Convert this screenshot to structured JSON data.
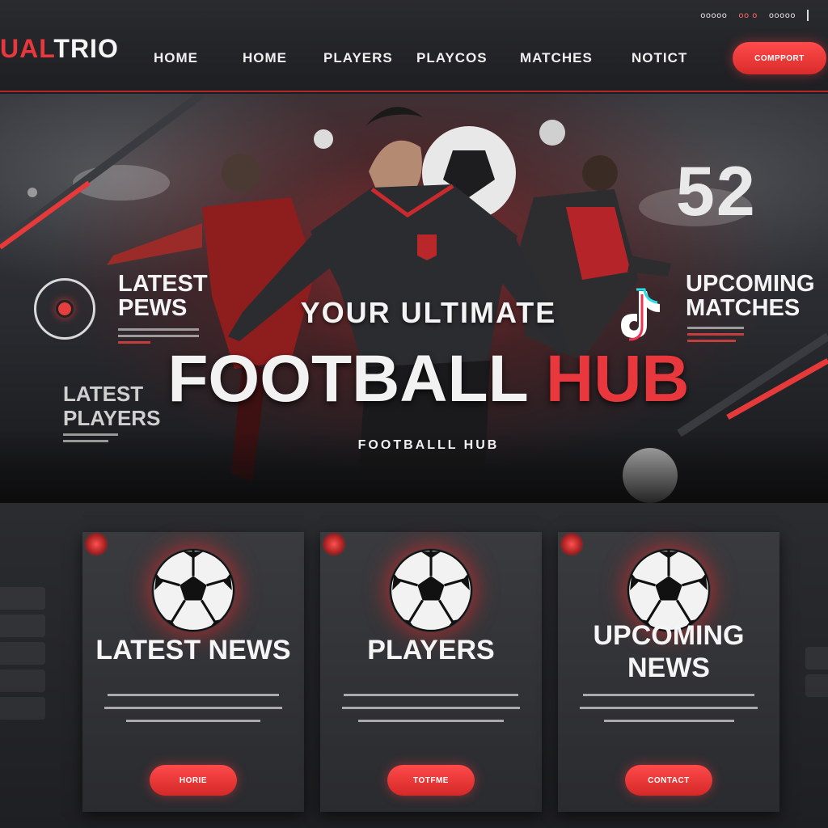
{
  "brand": {
    "logo_prefix": "UAL",
    "logo_main": "TRIO"
  },
  "utility": [
    "ooooo",
    "oo o",
    "ooooo"
  ],
  "nav": [
    "HOME",
    "HOME",
    "PLAYERS",
    "PLAYCOS",
    "MATCHES",
    "NOTICT"
  ],
  "header_cta": "COMPPORT",
  "hero": {
    "subtitle": "YOUR ULTIMATE",
    "title_main": "FOOTBALL",
    "title_accent": "HUB",
    "tagline": "FOOTBALLL HUB",
    "score": "52",
    "left_callout": "LATEST PEWS",
    "right_callout": "UPCOMING MATCHES",
    "left_lower": "LATEST PLAYERS"
  },
  "cards": [
    {
      "title": "LATEST NEWS",
      "button": "HORIE"
    },
    {
      "title": "PLAYERS",
      "button": "TOTFME"
    },
    {
      "title": "UPCOMING NEWS",
      "button": "CONTACT"
    }
  ],
  "colors": {
    "accent": "#e8383d",
    "background": "#1e1f22"
  },
  "icons": [
    "camera-icon",
    "tiktok-icon",
    "football-icon"
  ]
}
